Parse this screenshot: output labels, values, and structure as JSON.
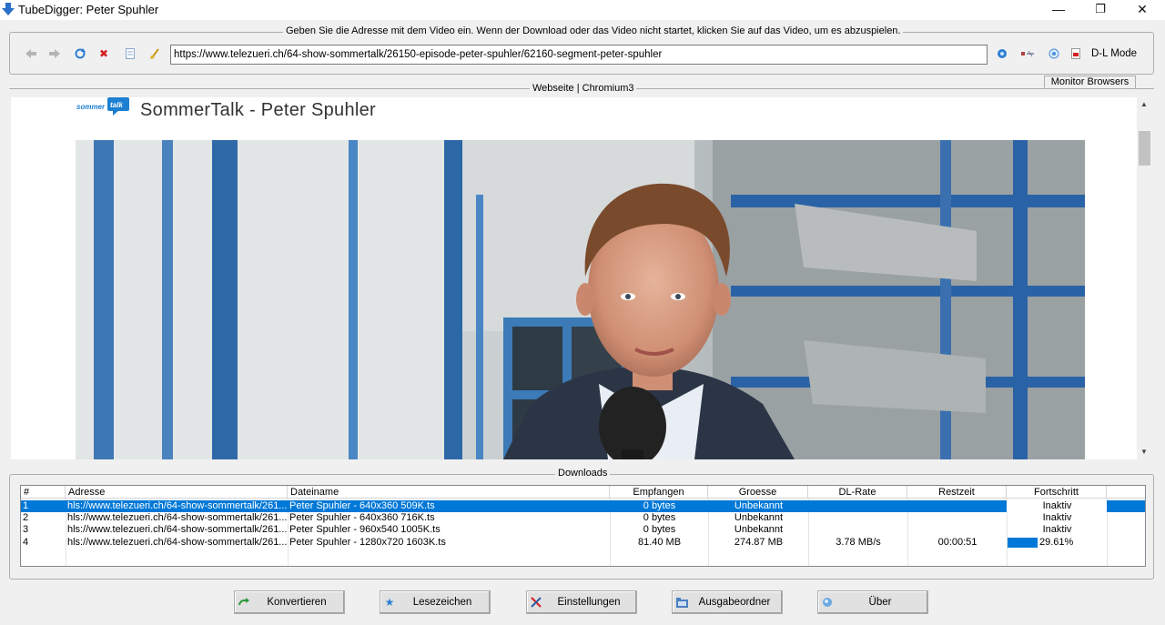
{
  "window": {
    "title": "TubeDigger: Peter Spuhler",
    "minimize_glyph": "—",
    "maximize_glyph": "❐",
    "close_glyph": "✕"
  },
  "address_group": {
    "legend": "Geben Sie die Adresse mit dem Video ein. Wenn der Download oder das Video nicht startet, klicken Sie auf das Video, um es abzuspielen.",
    "url": "https://www.telezueri.ch/64-show-sommertalk/26150-episode-peter-spuhler/62160-segment-peter-spuhler",
    "dl_mode_label": "D-L Mode",
    "toolbar_icons": [
      "back-icon",
      "forward-icon",
      "refresh-icon",
      "stop-icon",
      "page-icon",
      "clear-icon"
    ],
    "right_icons": [
      "browser-icon",
      "sniff-icon",
      "help-icon",
      "record-icon"
    ]
  },
  "browser_group": {
    "legend": "Webseite | Chromium3",
    "monitor_tab": "Monitor Browsers"
  },
  "webpage": {
    "logo_text": "sommer talk",
    "heading": "SommerTalk - Peter Spuhler"
  },
  "downloads": {
    "legend": "Downloads",
    "columns": [
      "#",
      "Adresse",
      "Dateiname",
      "Empfangen",
      "Groesse",
      "DL-Rate",
      "Restzeit",
      "Fortschritt"
    ],
    "rows": [
      {
        "num": "1",
        "adresse": "hls://www.telezueri.ch/64-show-sommertalk/261...",
        "dateiname": "Peter Spuhler - 640x360 509K.ts",
        "empfangen": "0 bytes",
        "groesse": "Unbekannt",
        "rate": "",
        "restzeit": "",
        "fortschritt": "Inaktiv",
        "progress": 0
      },
      {
        "num": "2",
        "adresse": "hls://www.telezueri.ch/64-show-sommertalk/261...",
        "dateiname": "Peter Spuhler - 640x360 716K.ts",
        "empfangen": "0 bytes",
        "groesse": "Unbekannt",
        "rate": "",
        "restzeit": "",
        "fortschritt": "Inaktiv",
        "progress": 0
      },
      {
        "num": "3",
        "adresse": "hls://www.telezueri.ch/64-show-sommertalk/261...",
        "dateiname": "Peter Spuhler - 960x540 1005K.ts",
        "empfangen": "0 bytes",
        "groesse": "Unbekannt",
        "rate": "",
        "restzeit": "",
        "fortschritt": "Inaktiv",
        "progress": 0
      },
      {
        "num": "4",
        "adresse": "hls://www.telezueri.ch/64-show-sommertalk/261...",
        "dateiname": "Peter Spuhler - 1280x720 1603K.ts",
        "empfangen": "81.40 MB",
        "groesse": "274.87 MB",
        "rate": "3.78 MB/s",
        "restzeit": "00:00:51",
        "fortschritt": "29.61%",
        "progress": 0.2961
      }
    ]
  },
  "buttons": {
    "konvertieren": "Konvertieren",
    "lesezeichen": "Lesezeichen",
    "einstellungen": "Einstellungen",
    "ausgabeordner": "Ausgabeordner",
    "ueber": "Über"
  },
  "colors": {
    "selection": "#0078d7",
    "logo_blue": "#1d7fd1"
  }
}
